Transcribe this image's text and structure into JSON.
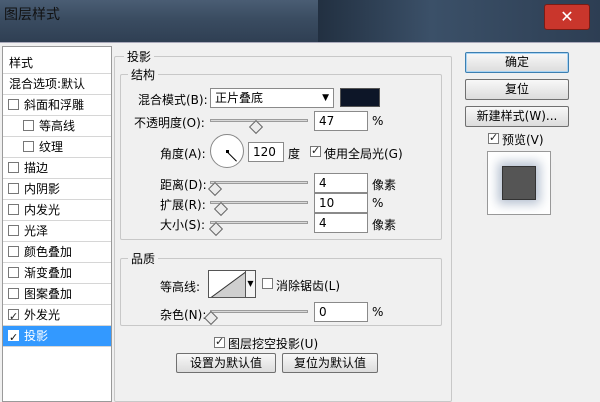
{
  "window": {
    "title": "图层样式",
    "close_glyph": "✕"
  },
  "sidebar": {
    "items": [
      {
        "label": "样式",
        "type": "header"
      },
      {
        "label": "混合选项:默认",
        "type": "header"
      },
      {
        "label": "斜面和浮雕",
        "checked": false
      },
      {
        "label": "等高线",
        "checked": false,
        "indent": true
      },
      {
        "label": "纹理",
        "checked": false,
        "indent": true
      },
      {
        "label": "描边",
        "checked": false
      },
      {
        "label": "内阴影",
        "checked": false
      },
      {
        "label": "内发光",
        "checked": false
      },
      {
        "label": "光泽",
        "checked": false
      },
      {
        "label": "颜色叠加",
        "checked": false
      },
      {
        "label": "渐变叠加",
        "checked": false
      },
      {
        "label": "图案叠加",
        "checked": false
      },
      {
        "label": "外发光",
        "checked": true
      },
      {
        "label": "投影",
        "checked": true,
        "selected": true
      }
    ]
  },
  "panel": {
    "section_title": "投影",
    "structure": {
      "title": "结构",
      "blend_mode_label": "混合模式(B):",
      "blend_mode_value": "正片叠底",
      "shadow_color": "#0d1628",
      "opacity_label": "不透明度(O):",
      "opacity_value": "47",
      "opacity_unit": "%",
      "opacity_fraction": 0.47,
      "angle_label": "角度(A):",
      "angle_value": "120",
      "angle_unit": "度",
      "global_light_label": "使用全局光(G)",
      "global_light_checked": true,
      "distance_label": "距离(D):",
      "distance_value": "4",
      "distance_unit": "像素",
      "spread_label": "扩展(R):",
      "spread_value": "10",
      "spread_unit": "%",
      "size_label": "大小(S):",
      "size_value": "4",
      "size_unit": "像素"
    },
    "quality": {
      "title": "品质",
      "contour_label": "等高线:",
      "anti_alias_label": "消除锯齿(L)",
      "anti_alias_checked": false,
      "noise_label": "杂色(N):",
      "noise_value": "0",
      "noise_unit": "%"
    },
    "knockout_label": "图层挖空投影(U)",
    "knockout_checked": true,
    "make_default_label": "设置为默认值",
    "reset_default_label": "复位为默认值"
  },
  "actions": {
    "ok_label": "确定",
    "reset_label": "复位",
    "new_style_label": "新建样式(W)...",
    "preview_label": "预览(V)",
    "preview_checked": true
  }
}
